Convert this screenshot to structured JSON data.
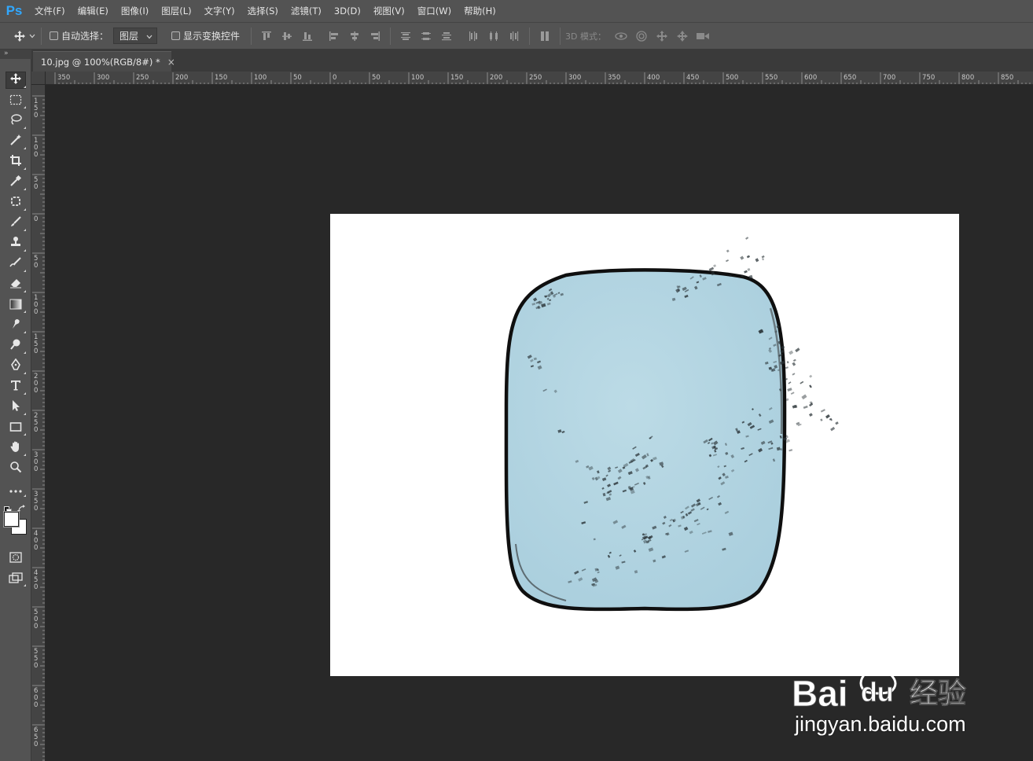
{
  "app": {
    "logo": "Ps"
  },
  "menu": [
    "文件(F)",
    "编辑(E)",
    "图像(I)",
    "图层(L)",
    "文字(Y)",
    "选择(S)",
    "滤镜(T)",
    "3D(D)",
    "视图(V)",
    "窗口(W)",
    "帮助(H)"
  ],
  "options": {
    "auto_select_label": "自动选择：",
    "auto_select_checked": false,
    "auto_select_target": "图层",
    "show_transform_label": "显示变换控件",
    "show_transform_checked": false,
    "mode_3d_label": "3D 模式："
  },
  "panel_collapse": "»",
  "document": {
    "tab_title": "10.jpg @ 100%(RGB/8#) *",
    "close_glyph": "×"
  },
  "ruler": {
    "horizontal_labels": [
      "350",
      "300",
      "250",
      "200",
      "150",
      "100",
      "50",
      "0",
      "50",
      "100",
      "150",
      "200",
      "250",
      "300",
      "350",
      "400",
      "450",
      "500",
      "550",
      "600",
      "650",
      "700",
      "750",
      "800",
      "850"
    ],
    "vertical_labels": [
      "150",
      "100",
      "50",
      "0",
      "50",
      "100",
      "150",
      "200",
      "250",
      "300",
      "350",
      "400",
      "450",
      "500",
      "550",
      "600",
      "650"
    ]
  },
  "tools": [
    {
      "name": "move-tool",
      "icon": "move-icon",
      "active": true
    },
    {
      "name": "marquee-tool",
      "icon": "rect-marquee-icon"
    },
    {
      "name": "lasso-tool",
      "icon": "lasso-icon"
    },
    {
      "name": "magic-wand-tool",
      "icon": "magic-wand-icon"
    },
    {
      "name": "crop-tool",
      "icon": "crop-icon"
    },
    {
      "name": "eyedropper-tool",
      "icon": "eyedropper-icon"
    },
    {
      "name": "patch-tool",
      "icon": "patch-icon"
    },
    {
      "name": "brush-tool",
      "icon": "brush-icon"
    },
    {
      "name": "clone-stamp-tool",
      "icon": "stamp-icon"
    },
    {
      "name": "history-brush-tool",
      "icon": "history-brush-icon"
    },
    {
      "name": "eraser-tool",
      "icon": "eraser-icon"
    },
    {
      "name": "gradient-tool",
      "icon": "gradient-icon"
    },
    {
      "name": "smudge-tool",
      "icon": "smudge-icon"
    },
    {
      "name": "dodge-tool",
      "icon": "dodge-icon"
    },
    {
      "name": "pen-tool",
      "icon": "pen-icon"
    },
    {
      "name": "type-tool",
      "icon": "type-icon"
    },
    {
      "name": "path-select-tool",
      "icon": "arrow-icon"
    },
    {
      "name": "shape-tool",
      "icon": "rectangle-icon"
    },
    {
      "name": "hand-tool",
      "icon": "hand-icon"
    },
    {
      "name": "zoom-tool",
      "icon": "zoom-icon"
    },
    {
      "name": "more-tools",
      "icon": "ellipsis-icon"
    }
  ],
  "colors": {
    "foreground": "#ffffff",
    "background": "#ffffff",
    "chrome": "#535353",
    "workspace": "#282828",
    "accent": "#31a8ff",
    "object_fill": "#b3d6e3",
    "object_stroke": "#111111"
  },
  "watermark": {
    "brand_latin": "Bai",
    "brand_du": "du",
    "brand_cn": "经验",
    "url": "jingyan.baidu.com"
  }
}
